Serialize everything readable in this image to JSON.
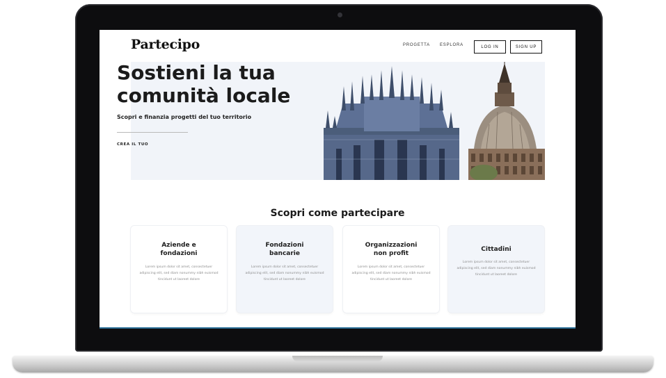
{
  "site": {
    "logo": "Partecipo",
    "nav": {
      "links": [
        "PROGETTA",
        "ESPLORA"
      ],
      "login_label": "LOG IN",
      "signup_label": "SIGN UP"
    },
    "hero": {
      "title": "Sostieni la tua comunità locale",
      "subtitle": "Scopri e finanzia progetti del tuo territorio",
      "cta": "CREA IL TUO"
    },
    "section_title": "Scopri come partecipare",
    "cards": [
      {
        "title": "Aziende e\nfondazioni",
        "body": "Lorem ipsum dolor sit amet, consectetuer adipiscing elit, sed diam nonummy nibh euismod tincidunt ut laoreet dolore"
      },
      {
        "title": "Fondazioni\nbancarie",
        "body": "Lorem ipsum dolor sit amet, consectetuer adipiscing elit, sed diam nonummy nibh euismod tincidunt ut laoreet dolore"
      },
      {
        "title": "Organizzazioni\nnon profit",
        "body": "Lorem ipsum dolor sit amet, consectetuer adipiscing elit, sed diam nonummy nibh euismod tincidunt ut laoreet dolore"
      },
      {
        "title": "Cittadini",
        "body": "Lorem ipsum dolor sit amet, consectetuer adipiscing elit, sed diam nonummy nibh euismod tincidunt ut laoreet dolore"
      }
    ]
  },
  "colors": {
    "hero_background": "#f1f4f9",
    "card_tint": "#f2f5fa",
    "text_dark": "#1b1b1b",
    "frame": "#0d0d0f"
  },
  "icons": [
    "webcam-icon",
    "milan-cathedral-illustration",
    "mole-antonelliana-illustration"
  ]
}
